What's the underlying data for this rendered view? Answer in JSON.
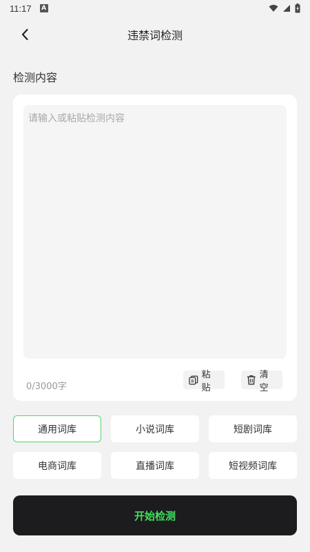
{
  "status_bar": {
    "time": "11:17",
    "notif_glyph": "A"
  },
  "header": {
    "title": "违禁词检测"
  },
  "section": {
    "label": "检测内容"
  },
  "editor": {
    "placeholder": "请输入或粘贴检测内容",
    "value": "",
    "char_count": "0/3000字",
    "paste_label": "粘贴",
    "clear_label": "清空"
  },
  "libraries": [
    {
      "label": "通用词库",
      "selected": true
    },
    {
      "label": "小说词库",
      "selected": false
    },
    {
      "label": "短剧词库",
      "selected": false
    },
    {
      "label": "电商词库",
      "selected": false
    },
    {
      "label": "直播词库",
      "selected": false
    },
    {
      "label": "短视频词库",
      "selected": false
    }
  ],
  "start_button": {
    "label": "开始检测"
  },
  "colors": {
    "accent": "#4cd964",
    "start_text": "#3ee05a",
    "start_bg": "#1c1c1e"
  }
}
